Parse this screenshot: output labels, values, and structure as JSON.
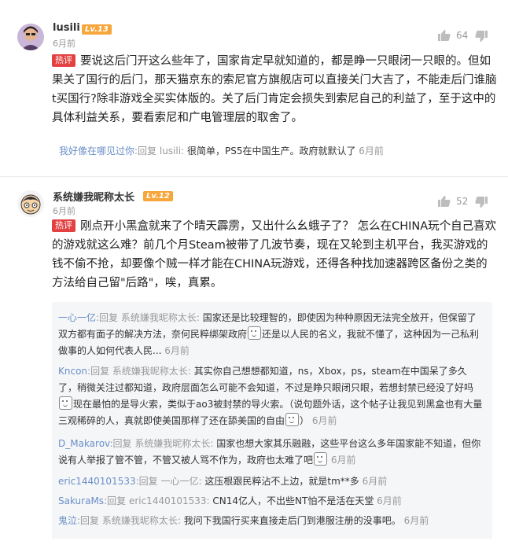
{
  "comments": [
    {
      "username": "lusili",
      "level": "Lv.13",
      "time": "6月前",
      "likes": "64",
      "tag": "热评",
      "body": "要说这后门开这么些年了，国家肯定早就知道的，都是睁一只眼闭一只眼的。但如果关了国行的后门，那天猫京东的索尼官方旗舰店可以直接关门大吉了，不能走后门谁脑t买国行?除非游戏全买实体版的。关了后门肯定会损失到索尼自己的利益了，至于这中的具体利益关系，要看索尼和广电管理层的取舍了。",
      "replies": [
        {
          "user": "我好像在哪见过你",
          "reply_word": ":回复",
          "target": "lusili:",
          "text": "很简单，PS5在中国生产。政府就默认了",
          "time": "6月前"
        }
      ]
    },
    {
      "username": "系统嫌我昵称太长",
      "level": "Lv.12",
      "time": "6月前",
      "likes": "52",
      "tag": "热评",
      "body": "刚点开小黑盒就来了个晴天霹雳，又出什么幺蛾子了？ 怎么在CHINA玩个自己喜欢的游戏就这么难？前几个月Steam被带了几波节奏，现在又轮到主机平台，我买游戏的钱不偷不抢，却要像个贼一样才能在CHINA玩游戏，还得各种找加速器跨区备份之类的方法给自己留\"后路\"，唉，真累。",
      "replies": [
        {
          "user": "一心一亿",
          "reply_word": ":回复",
          "target": "系统嫌我昵称太长:",
          "text_a": "国家还是比较理智的，即使因为种种原因无法完全放开，但保留了双方都有面子的解决方法，奈何民粹绑架政府",
          "text_b": "还是以人民的名义，我就不懂了，这种因为一己私利做事的人如何代表人民...",
          "time": "6月前"
        },
        {
          "user": "Kncon",
          "reply_word": ":回复",
          "target": "系统嫌我昵称太长:",
          "text_a": "其实你自己想想都知道，ns，Xbox，ps，steam在中国呆了多久了，稍微关注过都知道，政府层面怎么可能不会知道，不过是睁只眼闭只眼，若想封禁已经没了好吗",
          "text_b": "现在最怕的是导火索，类似于ao3被封禁的导火索。（说句题外话，这个帖子让我见到黑盒也有大量三观稀碎的人，真就即使美国那样了还在舔美国的自由",
          "text_c": "）",
          "time": "6月前"
        },
        {
          "user": "D_Makarov",
          "reply_word": ":回复",
          "target": "系统嫌我昵称太长:",
          "text_a": "国家也想大家其乐融融，这些平台这么多年国家能不知道，但你说有人举报了管不管，不管又被人骂不作为，政府也太难了吧",
          "time": "6月前"
        },
        {
          "user": "eric1440101533",
          "reply_word": ":回复",
          "target": "一心一亿:",
          "text": "这压根跟民粹沾不上边，就是tm**多",
          "time": "6月前"
        },
        {
          "user": "SakuraMs",
          "reply_word": ":回复",
          "target": "eric1440101533:",
          "text": "CN14亿人，不出些NT怕不是活在天堂",
          "time": "6月前"
        },
        {
          "user": "鬼泣",
          "reply_word": ":回复",
          "target": "系统嫌我昵称太长:",
          "text": "我问下我国行买来直接走后门到港服注册的没事吧。",
          "time": "6月前"
        }
      ]
    }
  ],
  "colors": {
    "level_badge": "#f7a63c",
    "hot_tag": "#e34141",
    "reply_user": "#6a8fc7",
    "reply_box": "#f5f6f8"
  },
  "icons": {
    "like": "thumb-up-icon",
    "dislike": "thumb-down-icon",
    "emoji": "emoji-face-icon"
  }
}
